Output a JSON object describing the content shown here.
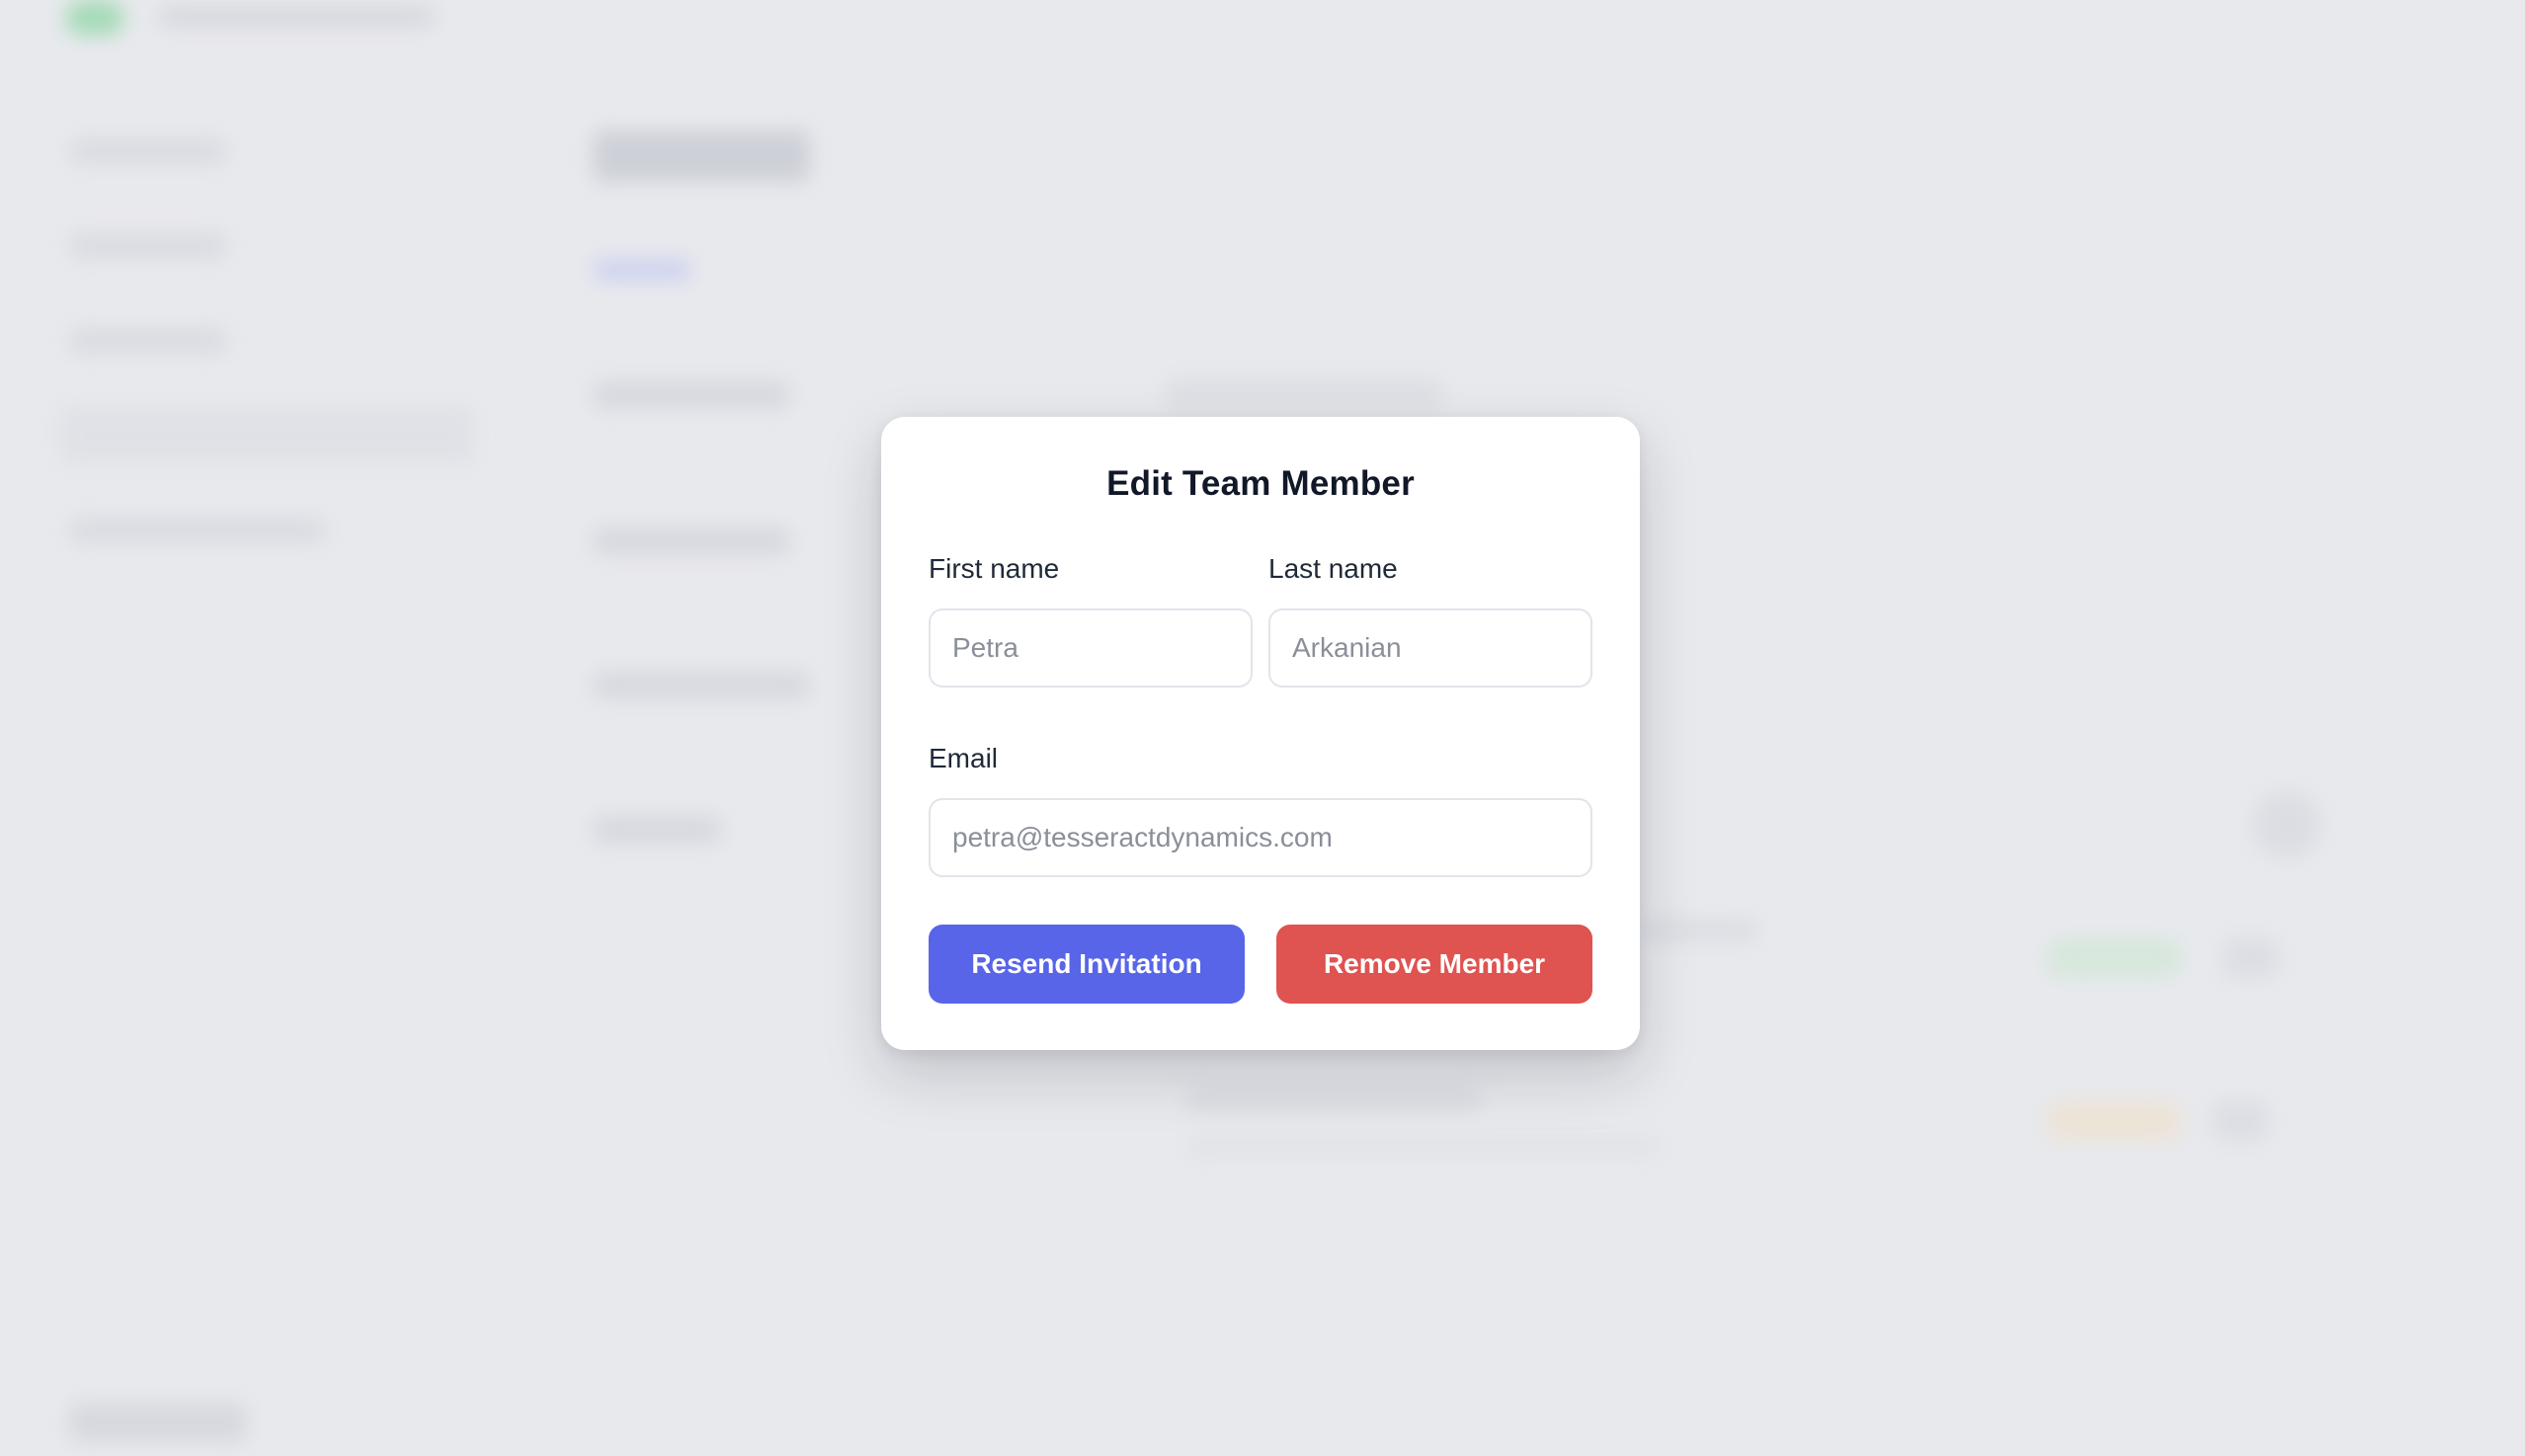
{
  "modal": {
    "title": "Edit Team Member",
    "first_name": {
      "label": "First name",
      "value": "Petra"
    },
    "last_name": {
      "label": "Last name",
      "value": "Arkanian"
    },
    "email": {
      "label": "Email",
      "value": "petra@tesseractdynamics.com"
    },
    "resend_label": "Resend Invitation",
    "remove_label": "Remove Member"
  },
  "colors": {
    "backdrop": "#e8e9ed",
    "primary": "#5865e8",
    "danger": "#df5350",
    "title": "#111827"
  }
}
